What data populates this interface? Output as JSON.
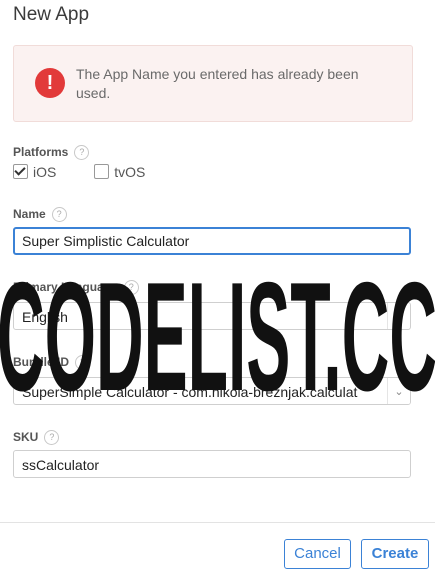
{
  "dialog": {
    "title": "New App"
  },
  "alert": {
    "message": "The App Name you entered has already been used."
  },
  "platforms": {
    "label": "Platforms",
    "help": "?",
    "options": [
      {
        "label": "iOS",
        "checked": true
      },
      {
        "label": "tvOS",
        "checked": false
      }
    ]
  },
  "name": {
    "label": "Name",
    "help": "?",
    "value": "Super Simplistic Calculator"
  },
  "primary_language": {
    "label": "Primary Language",
    "help": "?",
    "value": "English"
  },
  "bundle_id": {
    "label": "Bundle ID",
    "help": "?",
    "value": "SuperSimple Calculator - com.nikola-breznjak.calculat"
  },
  "sku": {
    "label": "SKU",
    "help": "?",
    "value": "ssCalculator"
  },
  "buttons": {
    "cancel": "Cancel",
    "create": "Create"
  },
  "watermark": {
    "text": "CODELIST.CC"
  },
  "colors": {
    "accent": "#3b82d6",
    "alert_bg": "#fbf2f1",
    "alert_icon": "#e23a3a"
  }
}
